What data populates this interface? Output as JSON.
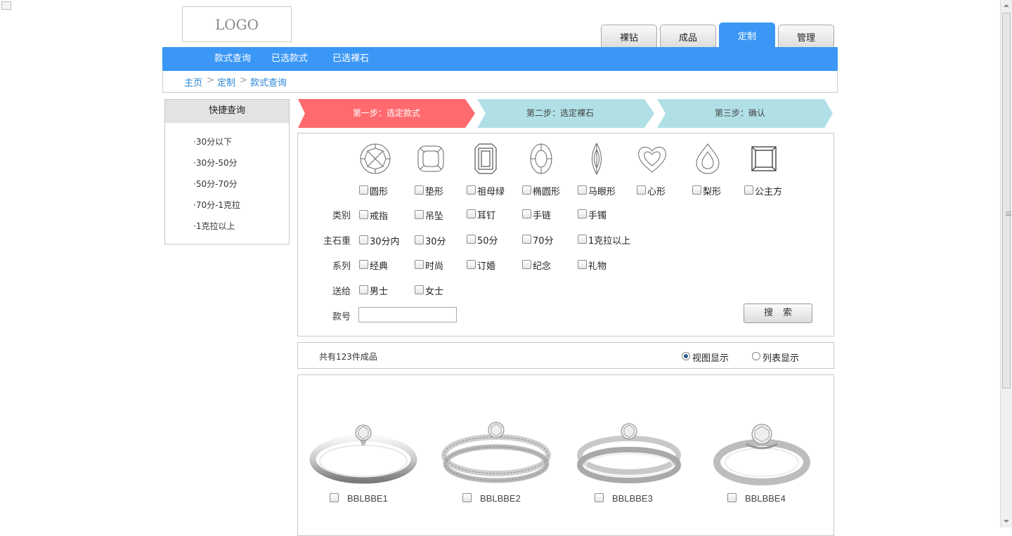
{
  "logo": {
    "text": "LOGO"
  },
  "top_tabs": [
    {
      "label": "裸钻",
      "active": false
    },
    {
      "label": "成品",
      "active": false
    },
    {
      "label": "定制",
      "active": true
    },
    {
      "label": "管理",
      "active": false
    }
  ],
  "subnav": [
    "款式查询",
    "已选款式",
    "已选裸石"
  ],
  "breadcrumb": {
    "items": [
      "主页",
      "定制",
      "款式查询"
    ],
    "separator": ">"
  },
  "quick_query": {
    "title": "快捷查询",
    "items": [
      "·30分以下",
      "·30分-50分",
      "·50分-70分",
      "·70分-1克拉",
      "·1克拉以上"
    ]
  },
  "steps": [
    {
      "label": "第一步：选定款式",
      "active": true
    },
    {
      "label": "第二步：选定裸石",
      "active": false
    },
    {
      "label": "第三步：确认",
      "active": false
    }
  ],
  "filters": {
    "shapes": [
      {
        "label": "圆形",
        "icon": "round-diamond-icon"
      },
      {
        "label": "垫形",
        "icon": "cushion-diamond-icon"
      },
      {
        "label": "祖母绿",
        "icon": "emerald-diamond-icon"
      },
      {
        "label": "椭圆形",
        "icon": "oval-diamond-icon"
      },
      {
        "label": "马眼形",
        "icon": "marquise-diamond-icon"
      },
      {
        "label": "心形",
        "icon": "heart-diamond-icon"
      },
      {
        "label": "梨形",
        "icon": "pear-diamond-icon"
      },
      {
        "label": "公主方",
        "icon": "princess-diamond-icon"
      }
    ],
    "category": {
      "label": "类别",
      "options": [
        "戒指",
        "吊坠",
        "耳钉",
        "手链",
        "手镯"
      ]
    },
    "weight": {
      "label": "主石重",
      "options": [
        "30分内",
        "30分",
        "50分",
        "70分",
        "1克拉以上"
      ]
    },
    "series": {
      "label": "系列",
      "options": [
        "经典",
        "时尚",
        "订婚",
        "纪念",
        "礼物"
      ]
    },
    "gift_for": {
      "label": "送给",
      "options": [
        "男士",
        "女士"
      ]
    },
    "sku": {
      "label": "款号",
      "value": ""
    },
    "search_label": "搜索"
  },
  "results": {
    "count_text": "共有123件成品",
    "view_options": [
      {
        "label": "视图显示",
        "selected": true
      },
      {
        "label": "列表显示",
        "selected": false
      }
    ]
  },
  "products": [
    {
      "code": "BBLBBE1"
    },
    {
      "code": "BBLBBE2"
    },
    {
      "code": "BBLBBE3"
    },
    {
      "code": "BBLBBE4"
    }
  ],
  "colors": {
    "accent": "#3a97f5",
    "step_active": "#ff6a6e",
    "step_inactive": "#b0e0e6",
    "link": "#2a86d6"
  }
}
